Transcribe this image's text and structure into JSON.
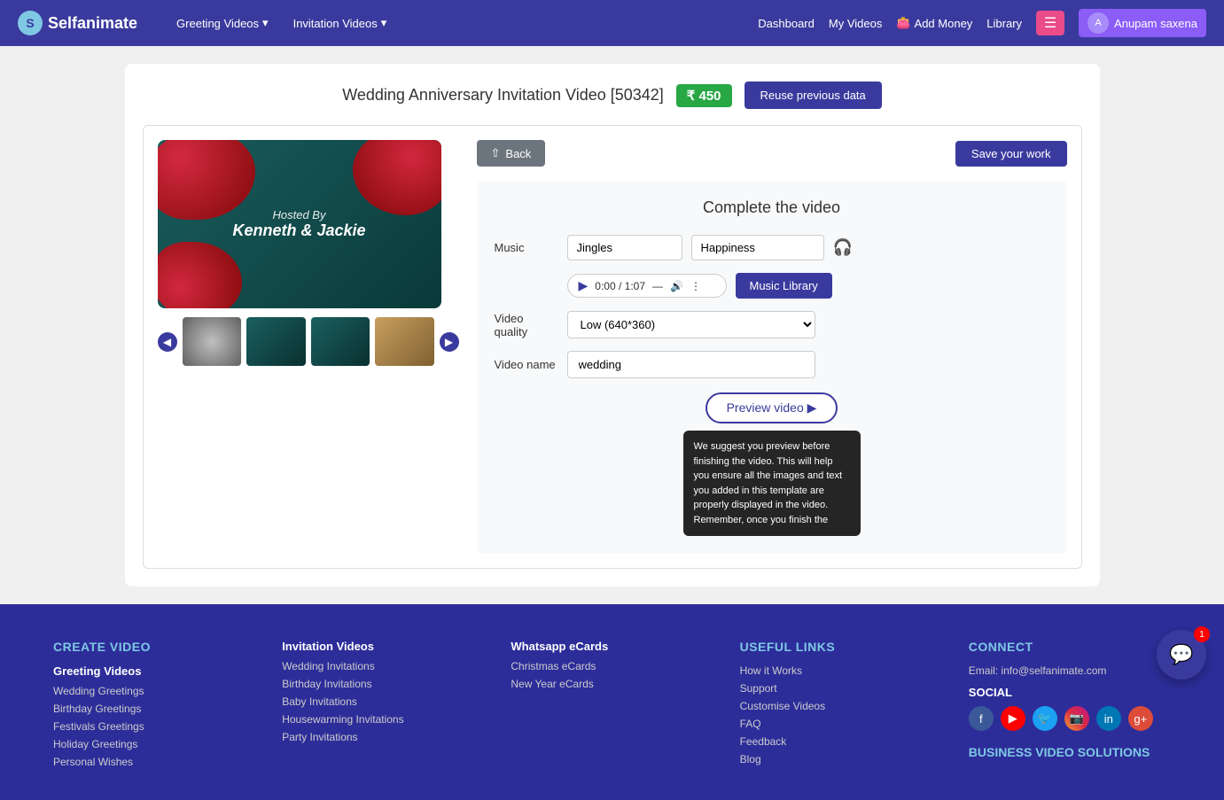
{
  "navbar": {
    "logo_text": "Selfanimate",
    "nav_greeting": "Greeting Videos",
    "nav_invitation": "Invitation Videos",
    "nav_dashboard": "Dashboard",
    "nav_my_videos": "My Videos",
    "nav_add_money": "Add Money",
    "nav_library": "Library",
    "nav_user": "Anupam saxena"
  },
  "content": {
    "title": "Wedding Anniversary Invitation Video [50342]",
    "price": "₹ 450",
    "reuse_btn": "Reuse previous data",
    "back_btn": "Back",
    "save_btn": "Save your work",
    "complete_title": "Complete the video",
    "music_label": "Music",
    "music_option": "Jingles",
    "happiness_option": "Happiness",
    "audio_time": "0:00 / 1:07",
    "music_lib_btn": "Music Library",
    "quality_label": "Video quality",
    "quality_option": "Low (640*360)",
    "name_label": "Video name",
    "video_name": "wedding",
    "preview_btn": "Preview video",
    "tooltip": "We suggest you preview before finishing the video. This will help you ensure all the images and text you added in this template are properly displayed in the video. Remember, once you finish the"
  },
  "thumbnails": [
    {
      "id": 1,
      "label": "thumb-1"
    },
    {
      "id": 2,
      "label": "thumb-2"
    },
    {
      "id": 3,
      "label": "thumb-3"
    },
    {
      "id": 4,
      "label": "thumb-4"
    }
  ],
  "footer": {
    "create_title": "CREATE VIDEO",
    "col1_title": "Greeting Videos",
    "col1_links": [
      "Wedding Greetings",
      "Birthday Greetings",
      "Festivals Greetings",
      "Holiday Greetings",
      "Personal Wishes"
    ],
    "col2_title": "Invitation Videos",
    "col2_links": [
      "Wedding Invitations",
      "Birthday Invitations",
      "Baby Invitations",
      "Housewarming Invitations",
      "Party Invitations"
    ],
    "col3_title": "Whatsapp eCards",
    "col3_links": [
      "Christmas eCards",
      "New Year eCards"
    ],
    "useful_title": "USEFUL LINKS",
    "useful_links": [
      "How it Works",
      "Support",
      "Customise Videos",
      "FAQ",
      "Feedback",
      "Blog"
    ],
    "connect_title": "CONNECT",
    "email": "Email: info@selfanimate.com",
    "social_title": "SOCIAL",
    "business_title": "BUSINESS VIDEO SOLUTIONS"
  },
  "chat": {
    "badge": "1"
  }
}
